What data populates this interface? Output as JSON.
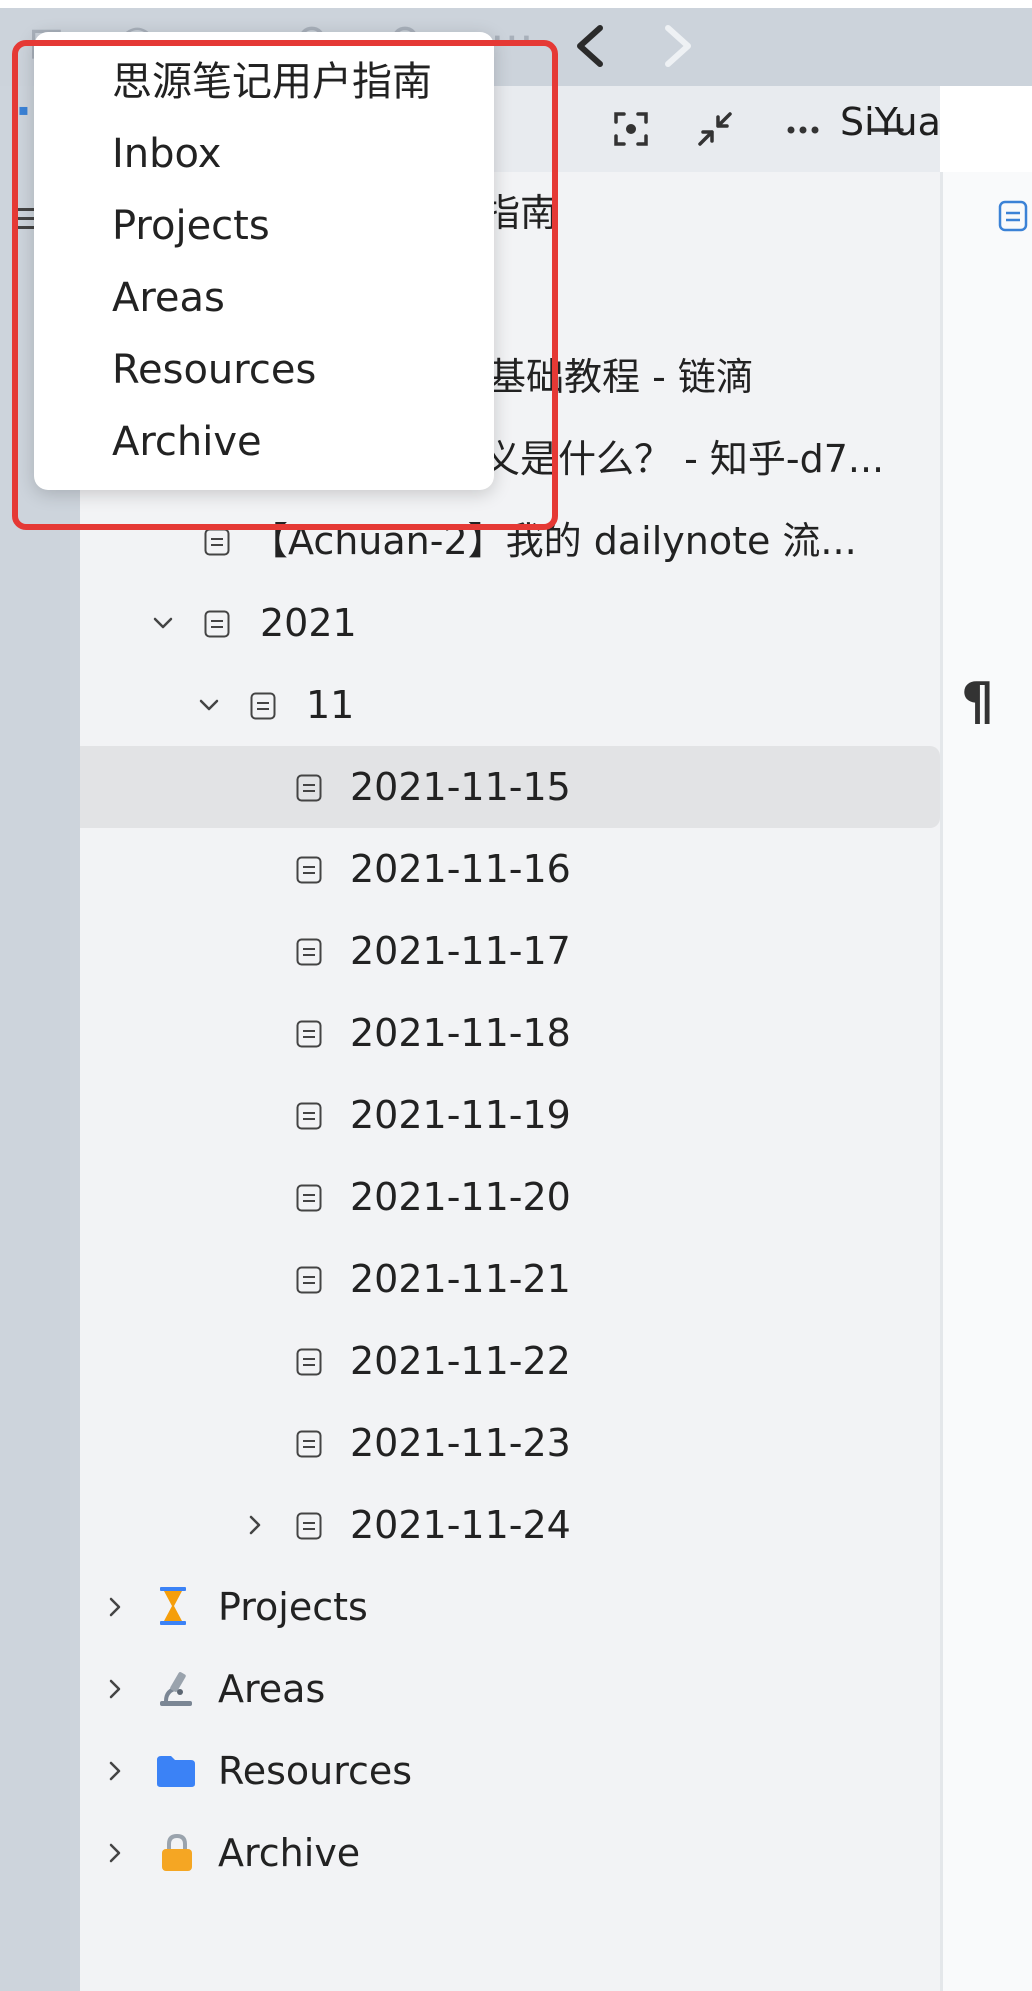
{
  "app": {
    "title_cut": "SiYua",
    "accent": "#3b82d6"
  },
  "colors": {
    "annotation_red": "#e53935",
    "projects_icon": "#f59e0b",
    "resources_icon": "#3b82f6",
    "archive_icon": "#f5a623"
  },
  "notebook_menu": {
    "items": [
      {
        "label": "思源笔记用户指南"
      },
      {
        "label": "Inbox"
      },
      {
        "label": "Projects"
      },
      {
        "label": "Areas"
      },
      {
        "label": "Resources"
      },
      {
        "label": "Archive"
      }
    ]
  },
  "tree": {
    "partial_rows": [
      {
        "text": "指南"
      },
      {
        "text": "基础教程 - 链滴"
      },
      {
        "text": "义是什么？ - 知乎-d7..."
      }
    ],
    "rows": [
      {
        "text": "【Achuan-2】我的 dailynote 流..."
      },
      {
        "text": "2021"
      },
      {
        "text": "11"
      },
      {
        "text": "2021-11-15"
      },
      {
        "text": "2021-11-16"
      },
      {
        "text": "2021-11-17"
      },
      {
        "text": "2021-11-18"
      },
      {
        "text": "2021-11-19"
      },
      {
        "text": "2021-11-20"
      },
      {
        "text": "2021-11-21"
      },
      {
        "text": "2021-11-22"
      },
      {
        "text": "2021-11-23"
      },
      {
        "text": "2021-11-24"
      }
    ],
    "notebooks": [
      {
        "label": "Projects",
        "icon": "hourglass-icon"
      },
      {
        "label": "Areas",
        "icon": "microscope-icon"
      },
      {
        "label": "Resources",
        "icon": "folder-icon"
      },
      {
        "label": "Archive",
        "icon": "lock-icon"
      }
    ]
  }
}
